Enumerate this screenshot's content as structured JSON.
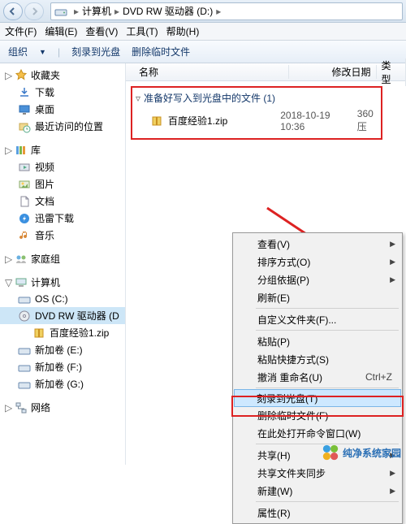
{
  "titlebar": {
    "path1": "计算机",
    "path2": "DVD RW 驱动器 (D:)"
  },
  "menubar": {
    "file": "文件(F)",
    "edit": "编辑(E)",
    "view": "查看(V)",
    "tools": "工具(T)",
    "help": "帮助(H)"
  },
  "toolbar": {
    "organize": "组织",
    "burn": "刻录到光盘",
    "deltemp": "删除临时文件"
  },
  "columns": {
    "name": "名称",
    "modified": "修改日期",
    "type": "类型"
  },
  "nav": {
    "favorites": "收藏夹",
    "downloads": "下载",
    "desktop": "桌面",
    "recent": "最近访问的位置",
    "libraries": "库",
    "videos": "视频",
    "pictures": "图片",
    "documents": "文档",
    "thunder": "迅雷下载",
    "music": "音乐",
    "homegroup": "家庭组",
    "computer": "计算机",
    "osc": "OS (C:)",
    "dvd": "DVD RW 驱动器 (D",
    "file_in_drive": "百度经验1.zip",
    "vol_e": "新加卷 (E:)",
    "vol_f": "新加卷 (F:)",
    "vol_g": "新加卷 (G:)",
    "network": "网络"
  },
  "files": {
    "group_heading": "准备好写入到光盘中的文件 (1)",
    "row1": {
      "name": "百度经验1.zip",
      "date": "2018-10-19 10:36",
      "type": "360压"
    }
  },
  "ctx": {
    "view": "查看(V)",
    "sort": "排序方式(O)",
    "group": "分组依据(P)",
    "refresh": "刷新(E)",
    "custom": "自定义文件夹(F)...",
    "paste": "粘贴(P)",
    "pasteshortcut": "粘贴快捷方式(S)",
    "undo_rename": "撤消 重命名(U)",
    "undo_shortcut": "Ctrl+Z",
    "burn": "刻录到光盘(T)",
    "deltemp": "删除临时文件(F)",
    "opencmd": "在此处打开命令窗口(W)",
    "share": "共享(H)",
    "sharesync": "共享文件夹同步",
    "new": "新建(W)",
    "properties": "属性(R)"
  },
  "watermark": "纯净系统家园"
}
